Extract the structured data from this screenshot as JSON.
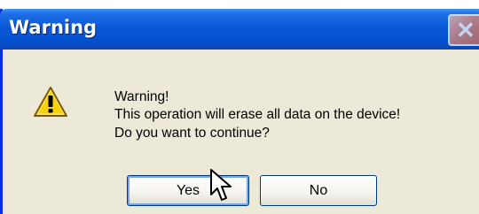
{
  "window": {
    "title": "Warning",
    "close_icon": "close-icon"
  },
  "message": {
    "icon": "warning-icon",
    "line1": "Warning!",
    "line2": "This operation will erase all data on the device!",
    "line3": "Do you want to continue?"
  },
  "buttons": {
    "yes_label": "Yes",
    "no_label": "No"
  },
  "colors": {
    "titlebar": "#0a58d6",
    "dialog_background": "#ece9d8",
    "warning_yellow": "#f5d20a"
  }
}
